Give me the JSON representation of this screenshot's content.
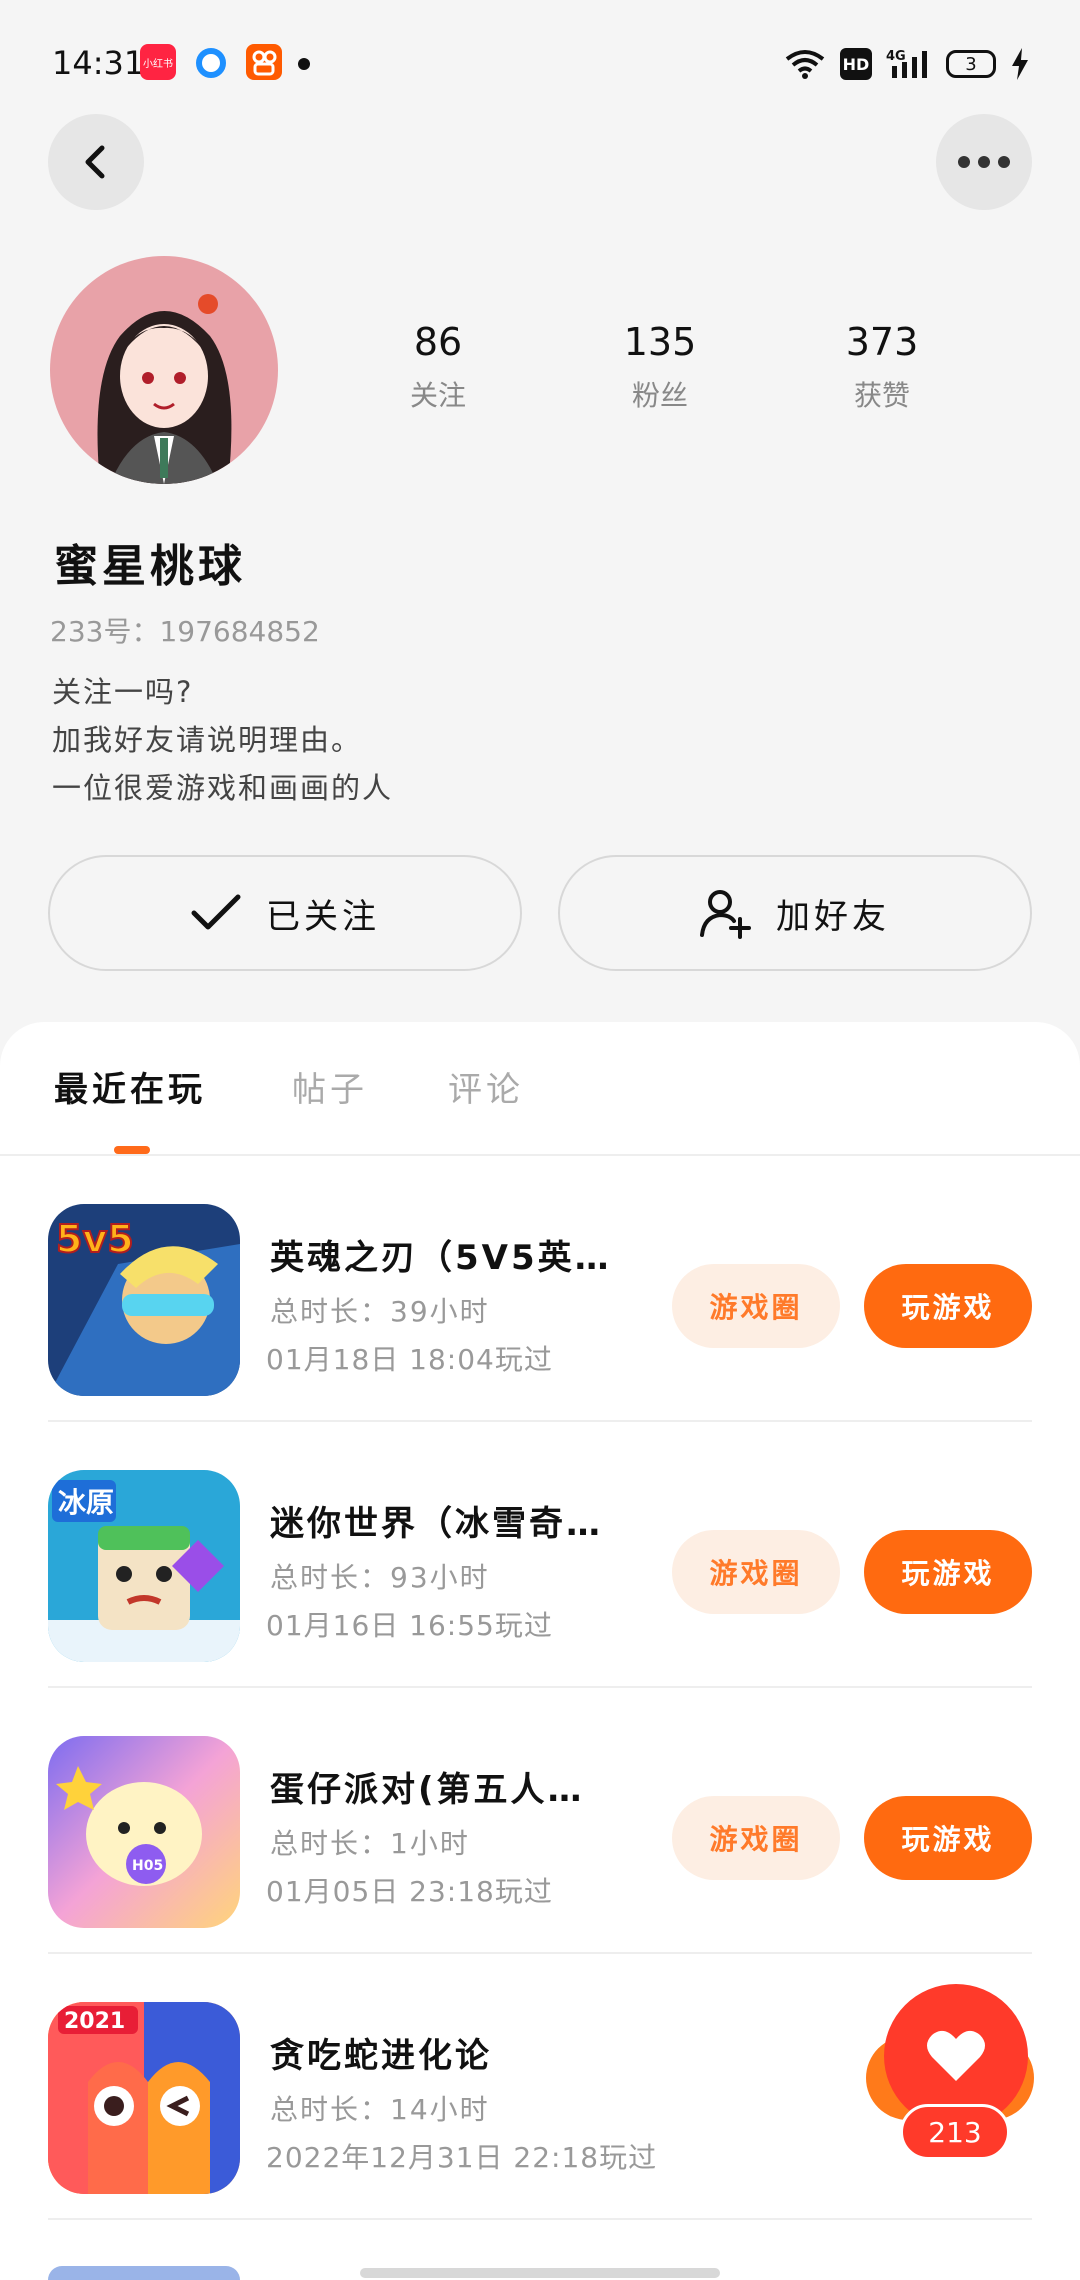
{
  "status_bar": {
    "time": "14:31",
    "xhs_label": "小红书",
    "battery": "3",
    "network": "4G"
  },
  "profile": {
    "name": "蜜星桃球",
    "uid": "233号：197684852",
    "bio": [
      "关注一吗?",
      "加我好友请说明理由。",
      "一位很爱游戏和画画的人"
    ],
    "stats": [
      {
        "value": "86",
        "label": "关注"
      },
      {
        "value": "135",
        "label": "粉丝"
      },
      {
        "value": "373",
        "label": "获赞"
      }
    ]
  },
  "actions": {
    "follow_label": "已关注",
    "friend_label": "加好友"
  },
  "tabs": [
    {
      "label": "最近在玩",
      "active": true
    },
    {
      "label": "帖子",
      "active": false
    },
    {
      "label": "评论",
      "active": false
    }
  ],
  "games": [
    {
      "title": "英魂之刃（5V5英…",
      "duration": "总时长：39小时",
      "last_played": "01月18日 18:04玩过",
      "icon_text": "5v5",
      "circle_label": "游戏圈",
      "play_label": "玩游戏"
    },
    {
      "title": "迷你世界（冰雪奇…",
      "duration": "总时长：93小时",
      "last_played": "01月16日 16:55玩过",
      "icon_text": "冰原",
      "circle_label": "游戏圈",
      "play_label": "玩游戏"
    },
    {
      "title": "蛋仔派对(第五人…",
      "duration": "总时长：1小时",
      "last_played": "01月05日 23:18玩过",
      "icon_text": "H05",
      "circle_label": "游戏圈",
      "play_label": "玩游戏"
    },
    {
      "title": "贪吃蛇进化论",
      "duration": "总时长：14小时",
      "last_played": "2022年12月31日 22:18玩过",
      "icon_text": "2021"
    }
  ],
  "like_float": {
    "count": "213"
  },
  "colors": {
    "accent": "#ff6a10",
    "accent_light": "#fdeee3",
    "like_red": "#ff3a2a"
  }
}
